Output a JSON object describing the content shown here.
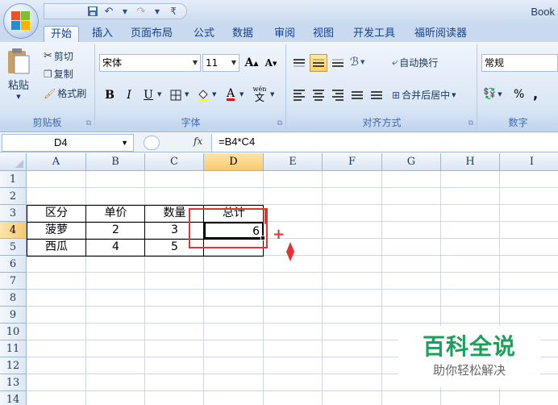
{
  "window": {
    "title": "Book"
  },
  "qat": {
    "save_icon": "save-icon",
    "undo_icon": "undo-icon",
    "redo_icon": "redo-icon",
    "customize_icon": "customize-icon"
  },
  "tabs": [
    "开始",
    "插入",
    "页面布局",
    "公式",
    "数据",
    "审阅",
    "视图",
    "开发工具",
    "福昕阅读器"
  ],
  "clipboard": {
    "paste": "粘贴",
    "cut": "剪切",
    "copy": "复制",
    "format_painter": "格式刷",
    "label": "剪贴板"
  },
  "font": {
    "name": "宋体",
    "size": "11",
    "grow": "A",
    "shrink": "A",
    "bold": "B",
    "italic": "I",
    "underline": "U",
    "font_color": "A",
    "phonetic": "wén",
    "label": "字体"
  },
  "alignment": {
    "wrap": "自动换行",
    "merge": "合并后居中",
    "label": "对齐方式"
  },
  "number": {
    "format": "常规",
    "percent": "%",
    "comma": ",",
    "label": "数字"
  },
  "formula_bar": {
    "name_box": "D4",
    "fx": "fx",
    "formula": "=B4*C4"
  },
  "columns": [
    "A",
    "B",
    "C",
    "D",
    "E",
    "F",
    "G",
    "H",
    "I"
  ],
  "rows": [
    "1",
    "2",
    "3",
    "4",
    "5",
    "6",
    "7",
    "8",
    "9",
    "10",
    "11",
    "12",
    "13",
    "14"
  ],
  "table": {
    "headers": [
      "区分",
      "单价",
      "数量",
      "总计"
    ],
    "rows": [
      [
        "菠萝",
        "2",
        "3",
        "6"
      ],
      [
        "西瓜",
        "4",
        "5",
        ""
      ]
    ]
  },
  "selected_cell": "D4",
  "annotation_color": "#e83030",
  "watermark": {
    "title": "百科全说",
    "subtitle": "助你轻松解决"
  }
}
